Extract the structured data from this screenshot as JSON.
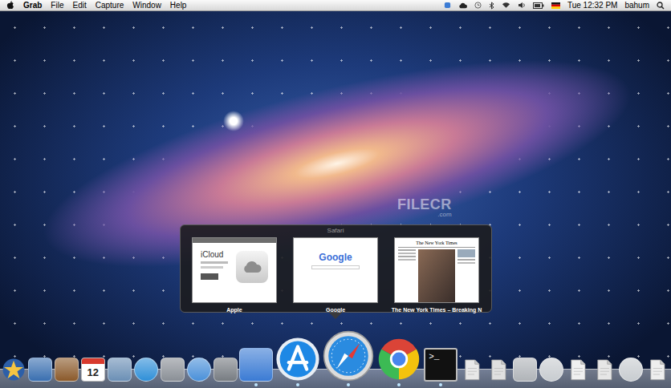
{
  "menu_bar": {
    "app": "Grab",
    "menus": [
      "File",
      "Edit",
      "Capture",
      "Window",
      "Help"
    ],
    "clock": "Tue 12:32 PM",
    "user": "bahum"
  },
  "watermark": {
    "text": "FILECR",
    "sub": ".com"
  },
  "window_switcher": {
    "title": "Safari",
    "windows": [
      {
        "label": "Apple",
        "heading": "iCloud",
        "kind": "apple"
      },
      {
        "label": "Google",
        "heading": "Google",
        "kind": "google"
      },
      {
        "label": "The New York Times – Breaking N",
        "heading": "The New York Times",
        "kind": "news"
      }
    ]
  },
  "dock": {
    "items": [
      {
        "kind": "star",
        "color": "#f5c542",
        "running": false,
        "hovered": false
      },
      {
        "kind": "square",
        "color": "#3a6fb0",
        "running": false,
        "hovered": false
      },
      {
        "kind": "square",
        "color": "#8b5a2b",
        "running": false,
        "hovered": false
      },
      {
        "kind": "calendar",
        "text": "12",
        "color": "#d83a2e",
        "running": false,
        "hovered": false
      },
      {
        "kind": "square",
        "color": "#6b8fb5",
        "running": false,
        "hovered": false
      },
      {
        "kind": "circle",
        "color": "#2f8fd8",
        "running": false,
        "hovered": false
      },
      {
        "kind": "square",
        "color": "#8a8f96",
        "running": false,
        "hovered": false
      },
      {
        "kind": "circle",
        "color": "#4a90d9",
        "running": false,
        "hovered": false
      },
      {
        "kind": "square",
        "color": "#777c82",
        "running": false,
        "hovered": false
      },
      {
        "kind": "square",
        "color": "#3b7bd4",
        "running": true,
        "hovered": false
      },
      {
        "kind": "appstore",
        "color": "#1e88e5",
        "running": true,
        "hovered": false
      },
      {
        "kind": "safari",
        "color": "#2a8be0",
        "running": true,
        "hovered": true
      },
      {
        "kind": "chrome",
        "color": "#db4437",
        "running": true,
        "hovered": false
      },
      {
        "kind": "terminal",
        "text": ">_",
        "color": "#111111",
        "running": true,
        "hovered": false
      },
      {
        "kind": "doc",
        "color": "#e8e8e8",
        "running": false,
        "hovered": false
      },
      {
        "kind": "doc",
        "color": "#e0e0e0",
        "running": false,
        "hovered": false
      },
      {
        "kind": "square",
        "color": "#b0b4b8",
        "running": false,
        "hovered": false
      },
      {
        "kind": "circle",
        "color": "#c8ccd0",
        "running": false,
        "hovered": false
      },
      {
        "kind": "doc",
        "color": "#f0f0f0",
        "running": false,
        "hovered": false
      },
      {
        "kind": "doc",
        "color": "#e6e6e6",
        "running": false,
        "hovered": false
      },
      {
        "kind": "circle",
        "color": "#c8ccd0",
        "running": false,
        "hovered": false
      },
      {
        "kind": "doc",
        "color": "#eeeeee",
        "running": false,
        "hovered": false
      }
    ]
  }
}
